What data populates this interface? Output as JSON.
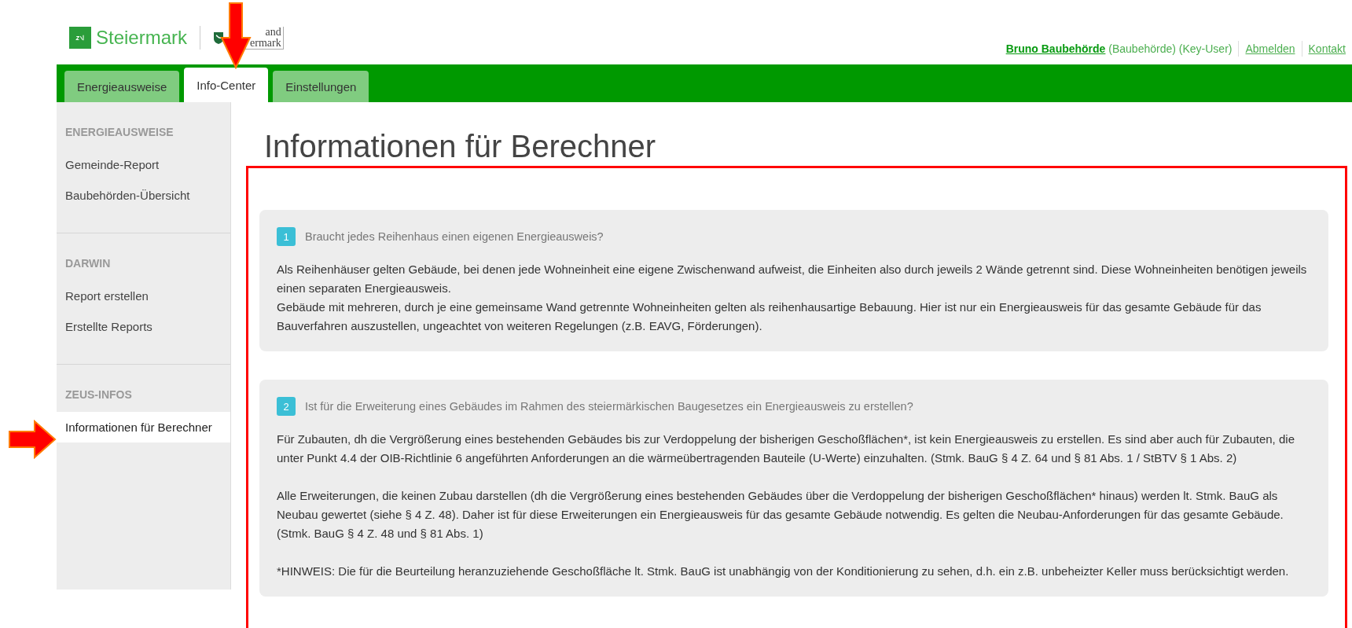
{
  "header": {
    "logo_text": "Steiermark",
    "partner_logo": [
      "and",
      "ermark"
    ],
    "user": {
      "name": "Bruno Baubehörde",
      "role": "(Baubehörde) (Key-User)"
    },
    "links": [
      "Abmelden",
      "Kontakt"
    ]
  },
  "tabs": [
    {
      "label": "Energieausweise",
      "selected": false
    },
    {
      "label": "Info-Center",
      "selected": true
    },
    {
      "label": "Einstellungen",
      "selected": false
    }
  ],
  "sidebar": {
    "sections": [
      {
        "title": "ENERGIEAUSWEISE",
        "items": [
          {
            "label": "Gemeinde-Report",
            "selected": false
          },
          {
            "label": "Baubehörden-Übersicht",
            "selected": false
          }
        ]
      },
      {
        "title": "DARWIN",
        "items": [
          {
            "label": "Report erstellen",
            "selected": false
          },
          {
            "label": "Erstellte Reports",
            "selected": false
          }
        ]
      },
      {
        "title": "ZEUS-INFOS",
        "items": [
          {
            "label": "Informationen für Berechner",
            "selected": true
          }
        ]
      }
    ]
  },
  "page_title": "Informationen für Berechner",
  "faqs": [
    {
      "number": "1",
      "question": "Braucht jedes Reihenhaus einen eigenen Energieausweis?",
      "paragraphs": [
        [
          "Als Reihenhäuser gelten Gebäude, bei denen jede Wohneinheit eine eigene Zwischenwand aufweist, die Einheiten also durch jeweils 2 Wände getrennt sind. Diese Wohneinheiten benötigen jeweils einen separaten Energieausweis.",
          "Gebäude mit mehreren, durch je eine gemeinsame Wand getrennte Wohneinheiten gelten als reihenhausartige Bebauung. Hier ist nur ein Energieausweis für das gesamte Gebäude für das Bauverfahren auszustellen, ungeachtet von weiteren Regelungen (z.B. EAVG, Förderungen)."
        ]
      ]
    },
    {
      "number": "2",
      "question": "Ist für die Erweiterung eines Gebäudes im Rahmen des steiermärkischen Baugesetzes ein Energieausweis zu erstellen?",
      "paragraphs": [
        [
          "Für Zubauten, dh die Vergrößerung eines bestehenden Gebäudes bis zur Verdoppelung der bisherigen Geschoßflächen*, ist kein Energieausweis zu erstellen. Es sind aber auch für Zubauten, die unter Punkt 4.4 der OIB-Richtlinie 6 angeführten Anforderungen an die wärmeübertragenden Bauteile (U-Werte) einzuhalten. (Stmk. BauG § 4 Z. 64 und § 81 Abs. 1 / StBTV § 1 Abs. 2)"
        ],
        [
          "Alle Erweiterungen, die keinen Zubau darstellen (dh die Vergrößerung eines bestehenden Gebäudes über die Verdoppelung der bisherigen Geschoßflächen* hinaus) werden lt. Stmk. BauG als Neubau gewertet (siehe § 4 Z. 48). Daher ist für diese Erweiterungen ein Energieausweis für das gesamte Gebäude notwendig. Es gelten die Neubau-Anforderungen für das gesamte Gebäude. (Stmk. BauG § 4 Z. 48 und § 81 Abs. 1)"
        ],
        [
          "*HINWEIS: Die für die Beurteilung heranzuziehende Geschoßfläche lt. Stmk. BauG ist unabhängig von der Konditionierung zu sehen, d.h. ein z.B. unbeheizter Keller muss berücksichtigt werden."
        ]
      ]
    }
  ]
}
